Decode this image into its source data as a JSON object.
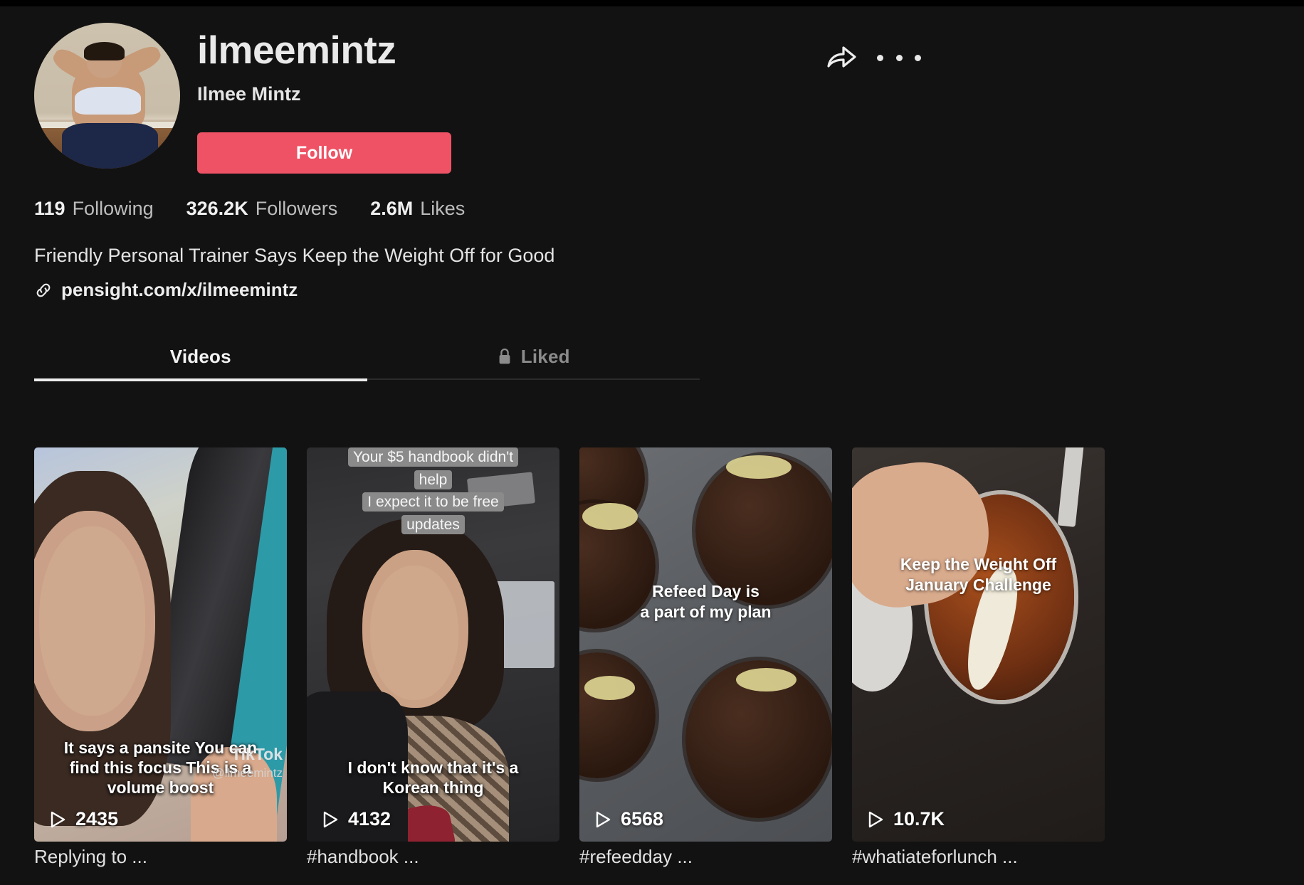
{
  "profile": {
    "username": "ilmeemintz",
    "display_name": "Ilmee Mintz",
    "follow_button": "Follow",
    "avatar_alt": "avatar",
    "bio": "Friendly Personal Trainer Says Keep the Weight Off for Good",
    "link": "pensight.com/x/ilmeemintz",
    "link_icon": "link-chain-icon",
    "share_icon": "share-arrow-icon",
    "more_icon": "more-options-icon"
  },
  "stats": [
    {
      "num": "119",
      "label": "Following"
    },
    {
      "num": "326.2K",
      "label": "Followers"
    },
    {
      "num": "2.6M",
      "label": "Likes"
    }
  ],
  "tabs": [
    {
      "label": "Videos",
      "active": true,
      "icon": null
    },
    {
      "label": "Liked",
      "active": false,
      "icon": "lock-icon"
    }
  ],
  "videos": [
    {
      "title": "Replying to ...",
      "views": "2435",
      "play_icon": "play-triangle-icon",
      "caption_bottom": "It says a pansite You can\nfind this focus This is a\nvolume boost",
      "caption_top": null,
      "caption_mid": null,
      "watermark_main": "TikTok",
      "watermark_sub": "@ilmeemintz"
    },
    {
      "title": "#handbook ...",
      "views": "4132",
      "play_icon": "play-triangle-icon",
      "caption_bottom": "I don't know that it's a\nKorean thing",
      "caption_top": "Your $5 handbook didn't\nhelp\nI expect it to be free\nupdates",
      "caption_mid": null,
      "watermark_main": null,
      "watermark_sub": null
    },
    {
      "title": "#refeedday ...",
      "views": "6568",
      "play_icon": "play-triangle-icon",
      "caption_bottom": null,
      "caption_top": null,
      "caption_mid": "Refeed Day is\na part of my plan",
      "watermark_main": null,
      "watermark_sub": null
    },
    {
      "title": "#whatiateforlunch ...",
      "views": "10.7K",
      "play_icon": "play-triangle-icon",
      "caption_bottom": null,
      "caption_top": null,
      "caption_mid": "Keep the Weight Off\nJanuary Challenge",
      "watermark_main": null,
      "watermark_sub": null
    }
  ],
  "colors": {
    "background": "#121212",
    "accent": "#ef5264",
    "text_primary": "#ededed",
    "text_secondary": "#bdbdbd"
  }
}
